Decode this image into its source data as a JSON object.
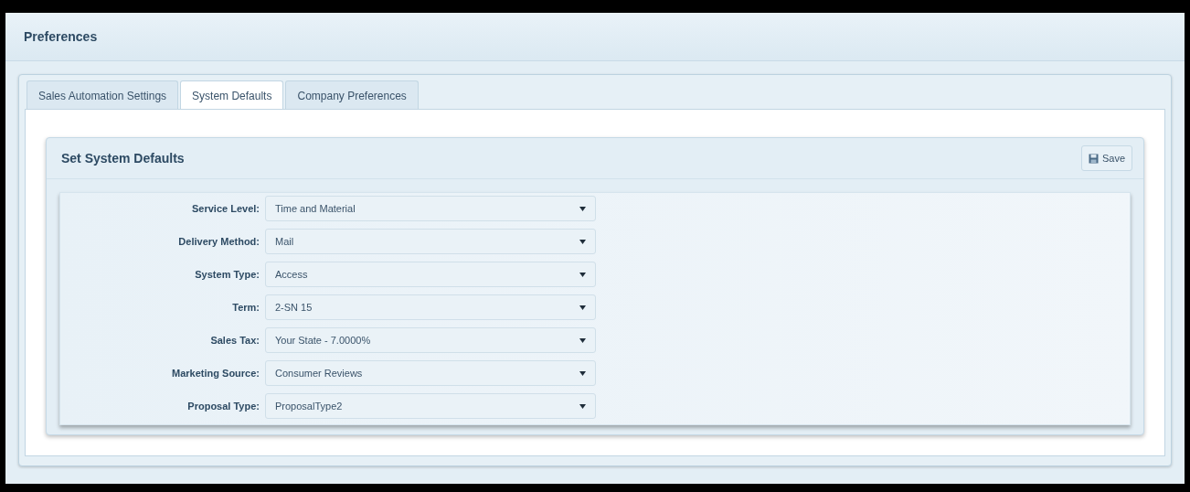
{
  "header": {
    "title": "Preferences"
  },
  "tabs": [
    {
      "label": "Sales Automation Settings",
      "selected": false
    },
    {
      "label": "System Defaults",
      "selected": true
    },
    {
      "label": "Company Preferences",
      "selected": false
    }
  ],
  "card": {
    "title": "Set System Defaults",
    "save_button": "Save"
  },
  "fields": [
    {
      "label": "Service Level:",
      "value": "Time and Material"
    },
    {
      "label": "Delivery Method:",
      "value": "Mail"
    },
    {
      "label": "System Type:",
      "value": "Access"
    },
    {
      "label": "Term:",
      "value": "2-SN 15"
    },
    {
      "label": "Sales Tax:",
      "value": "Your State - 7.0000%"
    },
    {
      "label": "Marketing Source:",
      "value": "Consumer Reviews"
    },
    {
      "label": "Proposal Type:",
      "value": "ProposalType2"
    }
  ]
}
